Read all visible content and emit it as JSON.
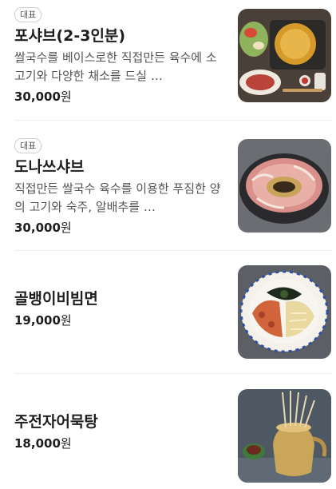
{
  "menu": {
    "items": [
      {
        "badge": "대표",
        "name": "포샤브(2-3인분)",
        "description": "쌀국수를 베이스로한 직접만든 육수에 소고기와 다양한 채소를 드실 …",
        "price": "30,000",
        "currency": "원",
        "image_icon": "pho-shabu-hotpot-photo"
      },
      {
        "badge": "대표",
        "name": "도나쓰샤브",
        "description": "직접만든 쌀국수 육수를 이용한 푸짐한 양의 고기와 숙주, 알배추를 …",
        "price": "30,000",
        "currency": "원",
        "image_icon": "donut-shabu-photo"
      },
      {
        "badge": "",
        "name": "골뱅이비빔면",
        "description": "",
        "price": "19,000",
        "currency": "원",
        "image_icon": "whelk-bibim-noodle-photo"
      },
      {
        "badge": "",
        "name": "주전자어묵탕",
        "description": "",
        "price": "18,000",
        "currency": "원",
        "image_icon": "kettle-fishcake-soup-photo"
      }
    ]
  }
}
